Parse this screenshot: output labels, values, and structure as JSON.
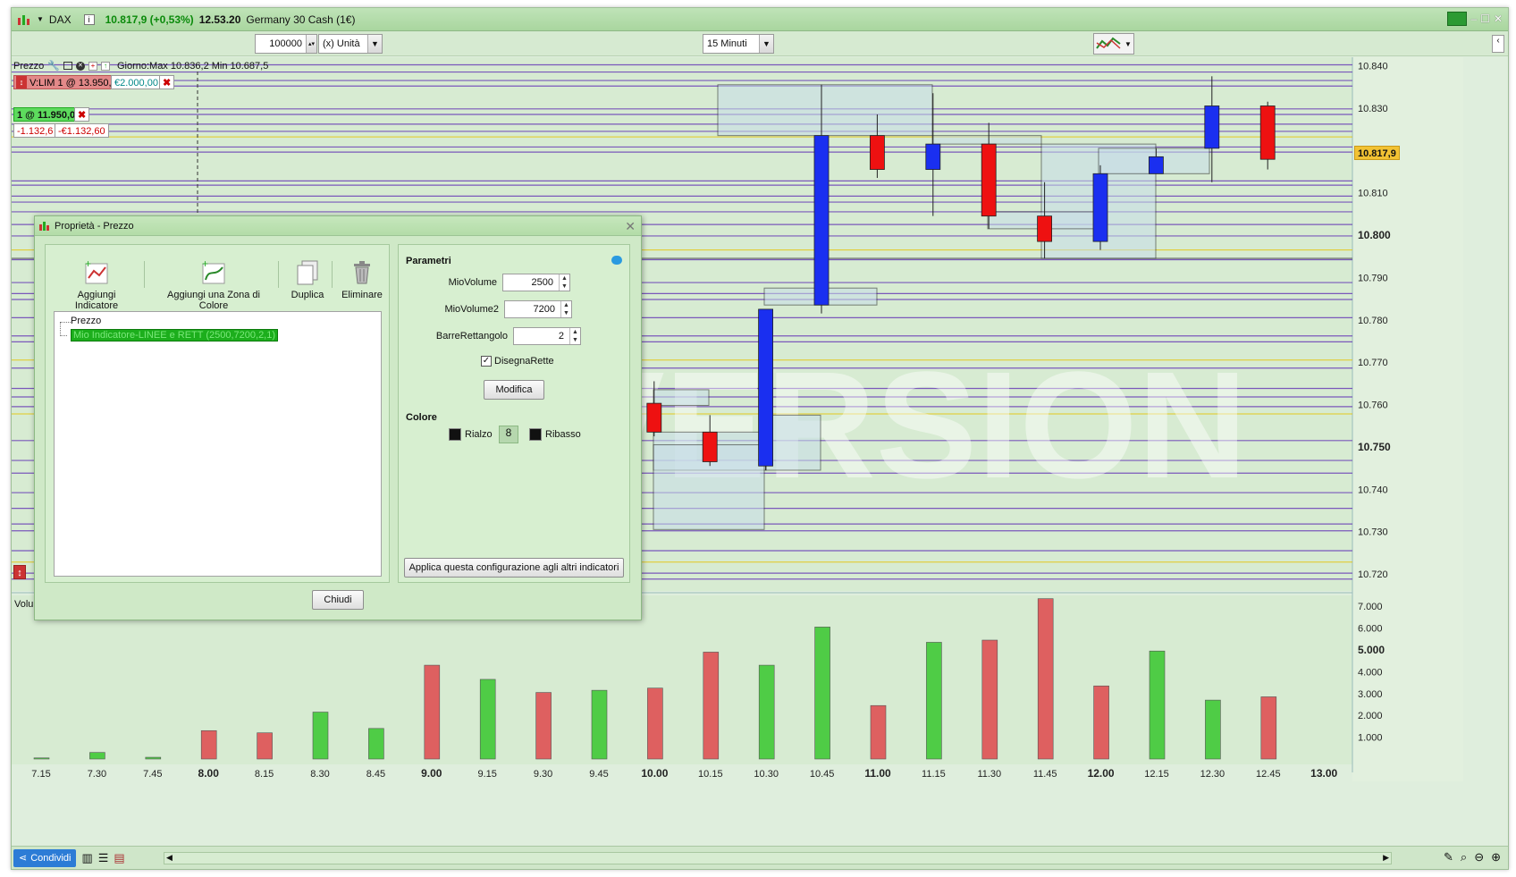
{
  "titlebar": {
    "instrument": "DAX",
    "price_change": "10.817,9 (+0,53%)",
    "time": "12.53.20",
    "name": "Germany 30 Cash (1€)"
  },
  "toolbar": {
    "quantity": "100000",
    "unit": "(x) Unità",
    "timeframe": "15 Minuti"
  },
  "chart": {
    "label": "Prezzo",
    "day_info": "Giorno:Max 10.836,2 Min 10.687,5",
    "order_tag": "V:LIM  1 @ 13.950,0",
    "order_value": "€2.000,00",
    "position_tag": "1 @ 11.950,0",
    "pl_points": "-1.132,6",
    "pl_money": "-€1.132,60",
    "current_price": "10.817,9",
    "volume_label": "Volu",
    "watermark": "DEMO VERSION"
  },
  "chart_data": [
    {
      "type": "candlestick",
      "x": [
        "7.15",
        "7.30",
        "7.45",
        "8.00",
        "8.15",
        "8.30",
        "8.45",
        "9.00",
        "9.15",
        "9.30",
        "9.45",
        "10.00",
        "10.15",
        "10.30",
        "10.45",
        "11.00",
        "11.15",
        "11.30",
        "11.45",
        "12.00",
        "12.15",
        "12.30",
        "12.45",
        "13.00"
      ],
      "y_ticks": [
        "10.840",
        "10.830",
        "10.820",
        "10.810",
        "10.800",
        "10.790",
        "10.780",
        "10.770",
        "10.760",
        "10.750",
        "10.740",
        "10.730",
        "10.720"
      ],
      "ylim": [
        10716,
        10842
      ],
      "visible_candles": [
        {
          "time": "10.00",
          "open": 10.7603,
          "high": 10.7655,
          "low": 10.7525,
          "close": 10.7535
        },
        {
          "time": "10.15",
          "open": 10.7535,
          "high": 10.7575,
          "low": 10.7455,
          "close": 10.7465
        },
        {
          "time": "10.30",
          "open": 10.7455,
          "high": 10.7825,
          "low": 10.7445,
          "close": 10.7825
        },
        {
          "time": "10.45",
          "open": 10.7835,
          "high": 10.8355,
          "low": 10.7815,
          "close": 10.8235
        },
        {
          "time": "11.00",
          "open": 10.8235,
          "high": 10.8285,
          "low": 10.8135,
          "close": 10.8155
        },
        {
          "time": "11.15",
          "open": 10.8155,
          "high": 10.8335,
          "low": 10.8045,
          "close": 10.8215
        },
        {
          "time": "11.30",
          "open": 10.8215,
          "high": 10.8265,
          "low": 10.8015,
          "close": 10.8045
        },
        {
          "time": "11.45",
          "open": 10.8045,
          "high": 10.8125,
          "low": 10.7945,
          "close": 10.7985
        },
        {
          "time": "12.00",
          "open": 10.7985,
          "high": 10.8165,
          "low": 10.7965,
          "close": 10.8145
        },
        {
          "time": "12.15",
          "open": 10.8145,
          "high": 10.8205,
          "low": 10.8145,
          "close": 10.8185
        },
        {
          "time": "12.30",
          "open": 10.8205,
          "high": 10.8375,
          "low": 10.8125,
          "close": 10.8305
        },
        {
          "time": "12.45",
          "open": 10.8305,
          "high": 10.8315,
          "low": 10.8155,
          "close": 10.8179
        }
      ]
    },
    {
      "type": "bar",
      "name": "Volume",
      "y_ticks": [
        "7.000",
        "6.000",
        "5.000",
        "4.000",
        "3.000",
        "2.000",
        "1.000"
      ],
      "ylim": [
        0,
        7500
      ],
      "categories": [
        "7.15",
        "7.30",
        "7.45",
        "8.00",
        "8.15",
        "8.30",
        "8.45",
        "9.00",
        "9.15",
        "9.30",
        "9.45",
        "10.00",
        "10.15",
        "10.30",
        "10.45",
        "11.00",
        "11.15",
        "11.30",
        "11.45",
        "12.00",
        "12.15",
        "12.30",
        "12.45"
      ],
      "values": [
        50,
        300,
        80,
        1300,
        1200,
        2150,
        1400,
        4300,
        3650,
        3050,
        3150,
        3250,
        4900,
        4300,
        6050,
        2450,
        5350,
        5450,
        7350,
        3350,
        4950,
        2700,
        2850
      ],
      "up": [
        true,
        true,
        true,
        false,
        false,
        true,
        true,
        false,
        true,
        false,
        true,
        false,
        false,
        true,
        true,
        false,
        true,
        false,
        false,
        false,
        true,
        true,
        false
      ]
    }
  ],
  "dialog": {
    "title": "Proprietà - Prezzo",
    "buttons": {
      "add_indicator": "Aggiungi Indicatore",
      "add_zone": "Aggiungi una Zona di Colore",
      "duplicate": "Duplica",
      "delete": "Eliminare"
    },
    "tree_root": "Prezzo",
    "tree_child": "Mio Indicatore-LINEE e RETT (2500,7200,2,1)",
    "params_title": "Parametri",
    "params": [
      {
        "label": "MioVolume",
        "value": "2500"
      },
      {
        "label": "MioVolume2",
        "value": "7200"
      },
      {
        "label": "BarreRettangolo",
        "value": "2"
      }
    ],
    "checkbox_label": "DisegnaRette",
    "modify": "Modifica",
    "color_title": "Colore",
    "rise": "Rialzo",
    "fall": "Ribasso",
    "apply_all": "Applica questa configurazione agli altri indicatori",
    "close": "Chiudi"
  },
  "bottombar": {
    "share": "Condividi"
  },
  "colors": {
    "up": "#1a2ff0",
    "down": "#ee1111",
    "vol_up": "#4fcc46",
    "vol_down": "#de6060",
    "bg": "#d7ebd2"
  }
}
